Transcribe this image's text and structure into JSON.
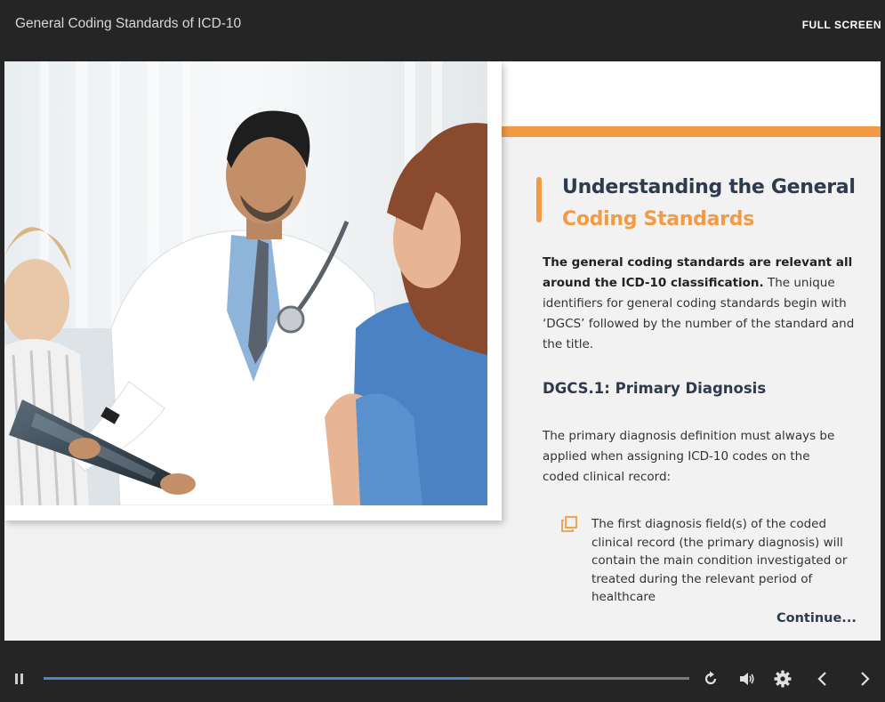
{
  "header": {
    "course_title": "General Coding Standards of ICD-10",
    "fullscreen_label": "FULL SCREEN"
  },
  "slide": {
    "heading_line1": "Understanding the General",
    "heading_line2": "Coding Standards",
    "intro_bold": "The general coding standards are relevant all around the ICD-10 classification.",
    "intro_rest": " The unique identifiers for general coding standards begin with ‘DGCS’ followed by the number of the standard and the title.",
    "subheading": "DGCS.1: Primary Diagnosis",
    "paragraph": "The primary diagnosis definition must always be applied when assigning ICD-10 codes on the coded clinical record:",
    "bullet": "The first diagnosis field(s) of the coded clinical record (the primary diagnosis) will contain the main condition investigated or treated during the relevant period of healthcare",
    "continue_label": "Continue..."
  },
  "player": {
    "progress_fraction": 0.655,
    "icons": [
      "pause-icon",
      "replay-icon",
      "volume-icon",
      "settings-icon",
      "chevron-left-icon",
      "chevron-right-icon"
    ],
    "colors": {
      "accent_orange": "#f39a45",
      "progress_blue": "#4d86c6",
      "bar_background": "#252525"
    }
  }
}
